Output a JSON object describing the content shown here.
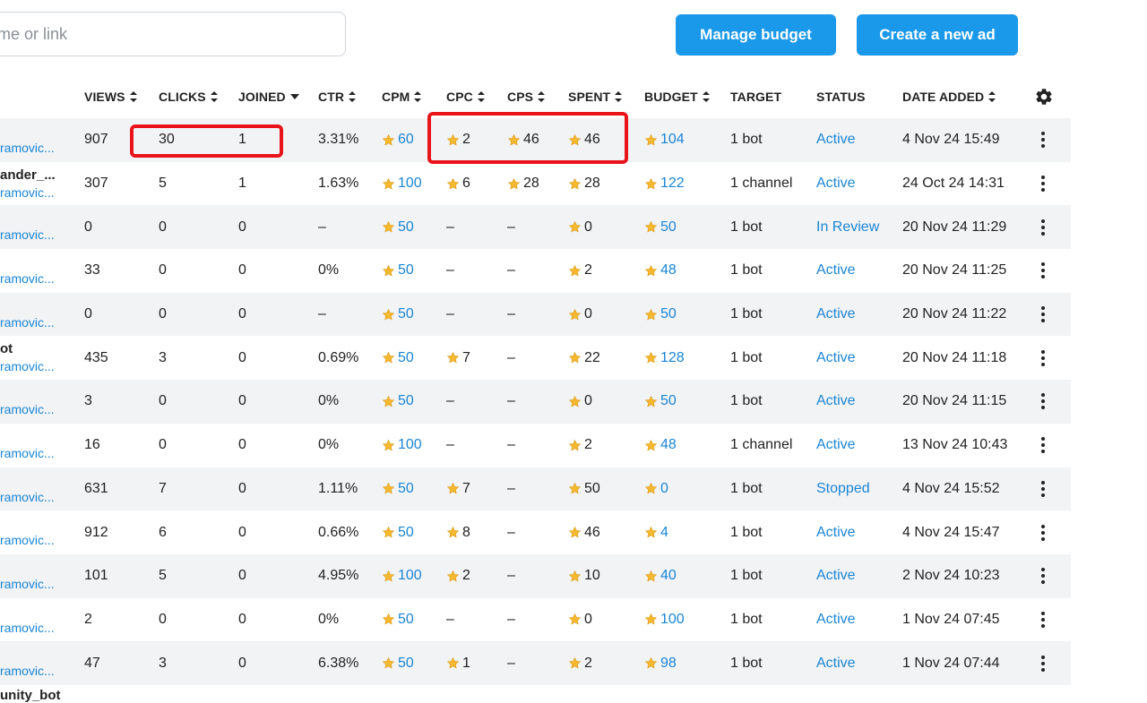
{
  "search": {
    "placeholder": "name or link"
  },
  "buttons": {
    "manage_budget": "Manage budget",
    "create_ad": "Create a new ad"
  },
  "columns": {
    "views": "VIEWS",
    "clicks": "CLICKS",
    "joined": "JOINED",
    "ctr": "CTR",
    "cpm": "CPM",
    "cpc": "CPC",
    "cps": "CPS",
    "spent": "SPENT",
    "budget": "BUDGET",
    "target": "TARGET",
    "status": "STATUS",
    "date_added": "DATE ADDED"
  },
  "icons": {
    "settings": "gear-icon",
    "row_menu": "more-vertical-icon",
    "currency": "star-icon"
  },
  "colors": {
    "accent": "#1a98ea",
    "link": "#1a86d6",
    "highlight": "#e8141a",
    "star": "#f5b82e"
  },
  "rows": [
    {
      "name": "",
      "handle": "ramovic...",
      "views": "907",
      "clicks": "30",
      "joined": "1",
      "ctr": "3.31%",
      "cpm": "60",
      "cpc": "2",
      "cps": "46",
      "spent": "46",
      "budget": "104",
      "target": "1 bot",
      "status": "Active",
      "date": "4 Nov 24 15:49"
    },
    {
      "name": "ander_...",
      "handle": "ramovic...",
      "views": "307",
      "clicks": "5",
      "joined": "1",
      "ctr": "1.63%",
      "cpm": "100",
      "cpc": "6",
      "cps": "28",
      "spent": "28",
      "budget": "122",
      "target": "1 channel",
      "status": "Active",
      "date": "24 Oct 24 14:31"
    },
    {
      "name": "",
      "handle": "ramovic...",
      "views": "0",
      "clicks": "0",
      "joined": "0",
      "ctr": "–",
      "cpm": "50",
      "cpc": "–",
      "cps": "–",
      "spent": "0",
      "budget": "50",
      "target": "1 bot",
      "status": "In Review",
      "date": "20 Nov 24 11:29"
    },
    {
      "name": "",
      "handle": "ramovic...",
      "views": "33",
      "clicks": "0",
      "joined": "0",
      "ctr": "0%",
      "cpm": "50",
      "cpc": "–",
      "cps": "–",
      "spent": "2",
      "budget": "48",
      "target": "1 bot",
      "status": "Active",
      "date": "20 Nov 24 11:25"
    },
    {
      "name": "",
      "handle": "ramovic...",
      "views": "0",
      "clicks": "0",
      "joined": "0",
      "ctr": "–",
      "cpm": "50",
      "cpc": "–",
      "cps": "–",
      "spent": "0",
      "budget": "50",
      "target": "1 bot",
      "status": "Active",
      "date": "20 Nov 24 11:22"
    },
    {
      "name": "ot",
      "handle": "ramovic...",
      "views": "435",
      "clicks": "3",
      "joined": "0",
      "ctr": "0.69%",
      "cpm": "50",
      "cpc": "7",
      "cps": "–",
      "spent": "22",
      "budget": "128",
      "target": "1 bot",
      "status": "Active",
      "date": "20 Nov 24 11:18"
    },
    {
      "name": "",
      "handle": "ramovic...",
      "views": "3",
      "clicks": "0",
      "joined": "0",
      "ctr": "0%",
      "cpm": "50",
      "cpc": "–",
      "cps": "–",
      "spent": "0",
      "budget": "50",
      "target": "1 bot",
      "status": "Active",
      "date": "20 Nov 24 11:15"
    },
    {
      "name": "",
      "handle": "ramovic...",
      "views": "16",
      "clicks": "0",
      "joined": "0",
      "ctr": "0%",
      "cpm": "100",
      "cpc": "–",
      "cps": "–",
      "spent": "2",
      "budget": "48",
      "target": "1 channel",
      "status": "Active",
      "date": "13 Nov 24 10:43"
    },
    {
      "name": "",
      "handle": "ramovic...",
      "views": "631",
      "clicks": "7",
      "joined": "0",
      "ctr": "1.11%",
      "cpm": "50",
      "cpc": "7",
      "cps": "–",
      "spent": "50",
      "budget": "0",
      "target": "1 bot",
      "status": "Stopped",
      "date": "4 Nov 24 15:52"
    },
    {
      "name": "",
      "handle": "ramovic...",
      "views": "912",
      "clicks": "6",
      "joined": "0",
      "ctr": "0.66%",
      "cpm": "50",
      "cpc": "8",
      "cps": "–",
      "spent": "46",
      "budget": "4",
      "target": "1 bot",
      "status": "Active",
      "date": "4 Nov 24 15:47"
    },
    {
      "name": "",
      "handle": "ramovic...",
      "views": "101",
      "clicks": "5",
      "joined": "0",
      "ctr": "4.95%",
      "cpm": "100",
      "cpc": "2",
      "cps": "–",
      "spent": "10",
      "budget": "40",
      "target": "1 bot",
      "status": "Active",
      "date": "2 Nov 24 10:23"
    },
    {
      "name": "",
      "handle": "ramovic...",
      "views": "2",
      "clicks": "0",
      "joined": "0",
      "ctr": "0%",
      "cpm": "50",
      "cpc": "–",
      "cps": "–",
      "spent": "0",
      "budget": "100",
      "target": "1 bot",
      "status": "Active",
      "date": "1 Nov 24 07:45"
    },
    {
      "name": "",
      "handle": "ramovic...",
      "views": "47",
      "clicks": "3",
      "joined": "0",
      "ctr": "6.38%",
      "cpm": "50",
      "cpc": "1",
      "cps": "–",
      "spent": "2",
      "budget": "98",
      "target": "1 bot",
      "status": "Active",
      "date": "1 Nov 24 07:44"
    }
  ],
  "partial_row_name": "unity_bot"
}
